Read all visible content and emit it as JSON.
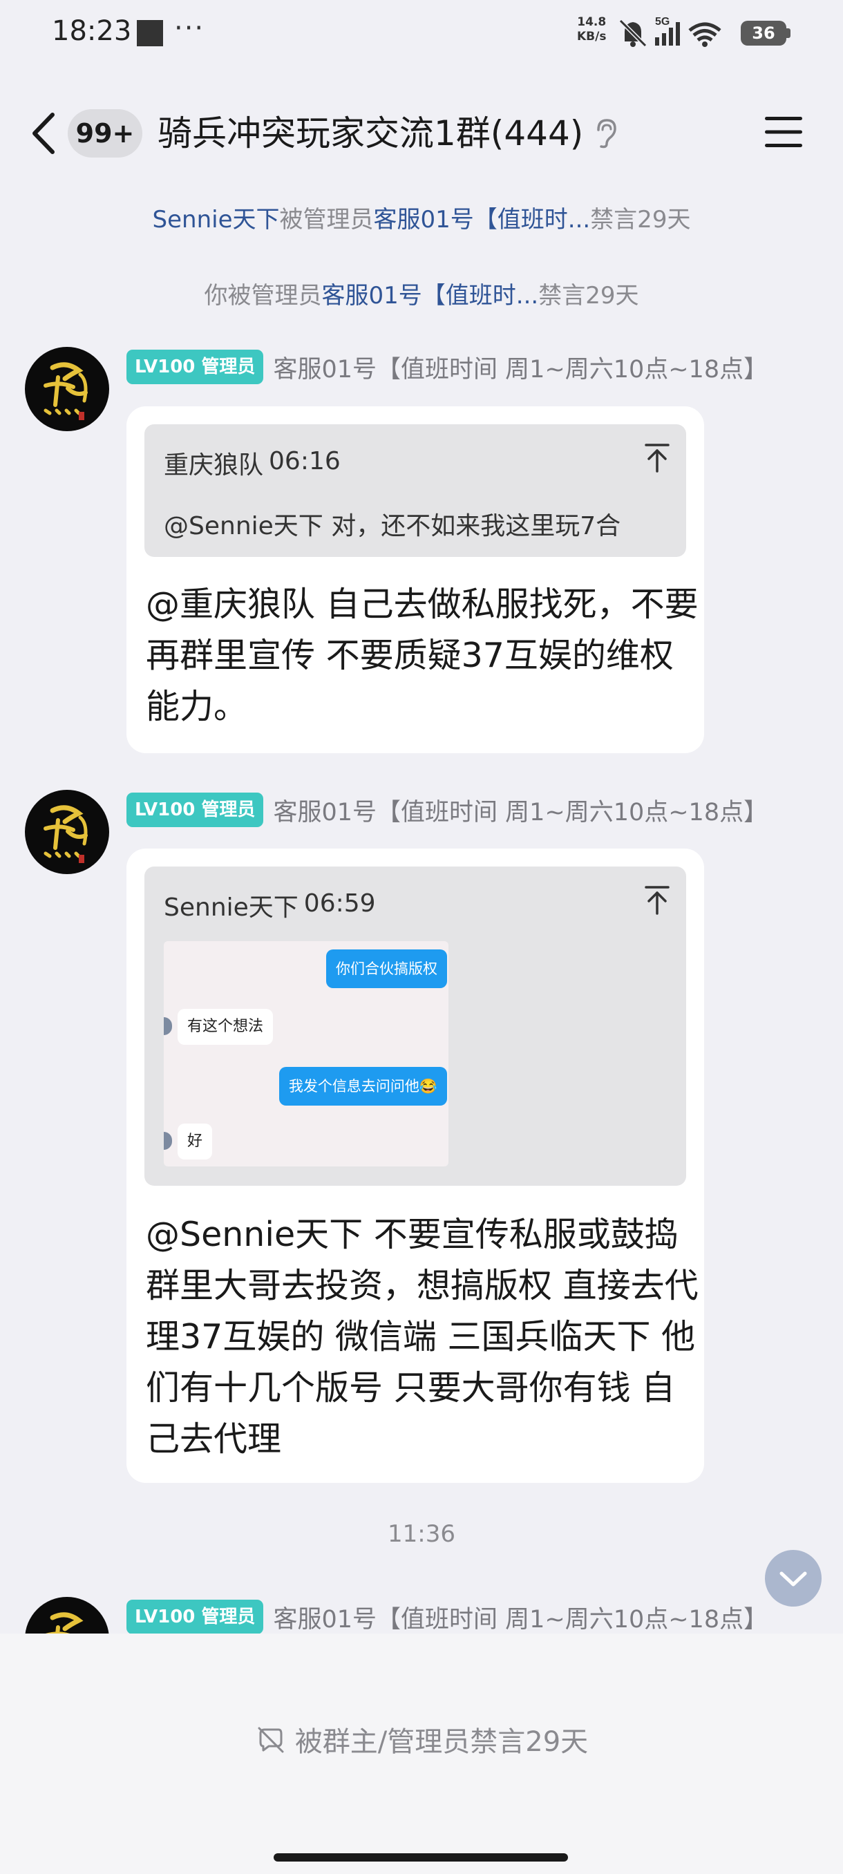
{
  "status_bar": {
    "time": "18:23",
    "dots": "···",
    "speed_value": "14.8",
    "speed_unit": "KB/s",
    "network": "5G",
    "battery": "36"
  },
  "header": {
    "back_icon": "chevron-left-icon",
    "unread_badge": "99+",
    "title": "骑兵冲突玩家交流1群(444)",
    "ear_icon": "ear-icon",
    "menu_icon": "hamburger-menu-icon"
  },
  "system_notices": [
    {
      "part1": "Sennie天下",
      "part2": "被管理员",
      "part3": "客服01号【值班时...",
      "part4": "禁言29天"
    },
    {
      "part1": "你被管理员",
      "part2": "客服01号【值班时...",
      "part3": "禁言29天"
    }
  ],
  "messages": [
    {
      "badge": "LV100 管理员",
      "sender": "客服01号【值班时间 周1~周六10点~18点】",
      "quote_author": "重庆狼队",
      "quote_time": "06:16",
      "quote_text": "@Sennie天下 对，还不如来我这里玩7合",
      "text": "@重庆狼队 自己去做私服找死，不要再群里宣传   不要质疑37互娱的维权能力。"
    },
    {
      "badge": "LV100 管理员",
      "sender": "客服01号【值班时间 周1~周六10点~18点】",
      "quote_author": "Sennie天下",
      "quote_time": "06:59",
      "quote_image": {
        "bubbles": [
          "你们合伙搞版权",
          "有这个想法",
          "我发个信息去问问他😂",
          "好"
        ]
      },
      "text": "@Sennie天下 不要宣传私服或鼓捣群里大哥去投资，想搞版权 直接去代理37互娱的 微信端  三国兵临天下  他们有十几个版号  只要大哥你有钱 自己去代理"
    },
    {
      "badge": "LV100 管理员",
      "sender": "客服01号【值班时间 周1~周六10点~18点】"
    }
  ],
  "time_separator": "11:36",
  "bottom": {
    "muted_text": "被群主/管理员禁言29天"
  },
  "colors": {
    "accent_blue": "#2f5496",
    "badge_teal": "#3dc7c1",
    "background": "#f0f0f5"
  }
}
